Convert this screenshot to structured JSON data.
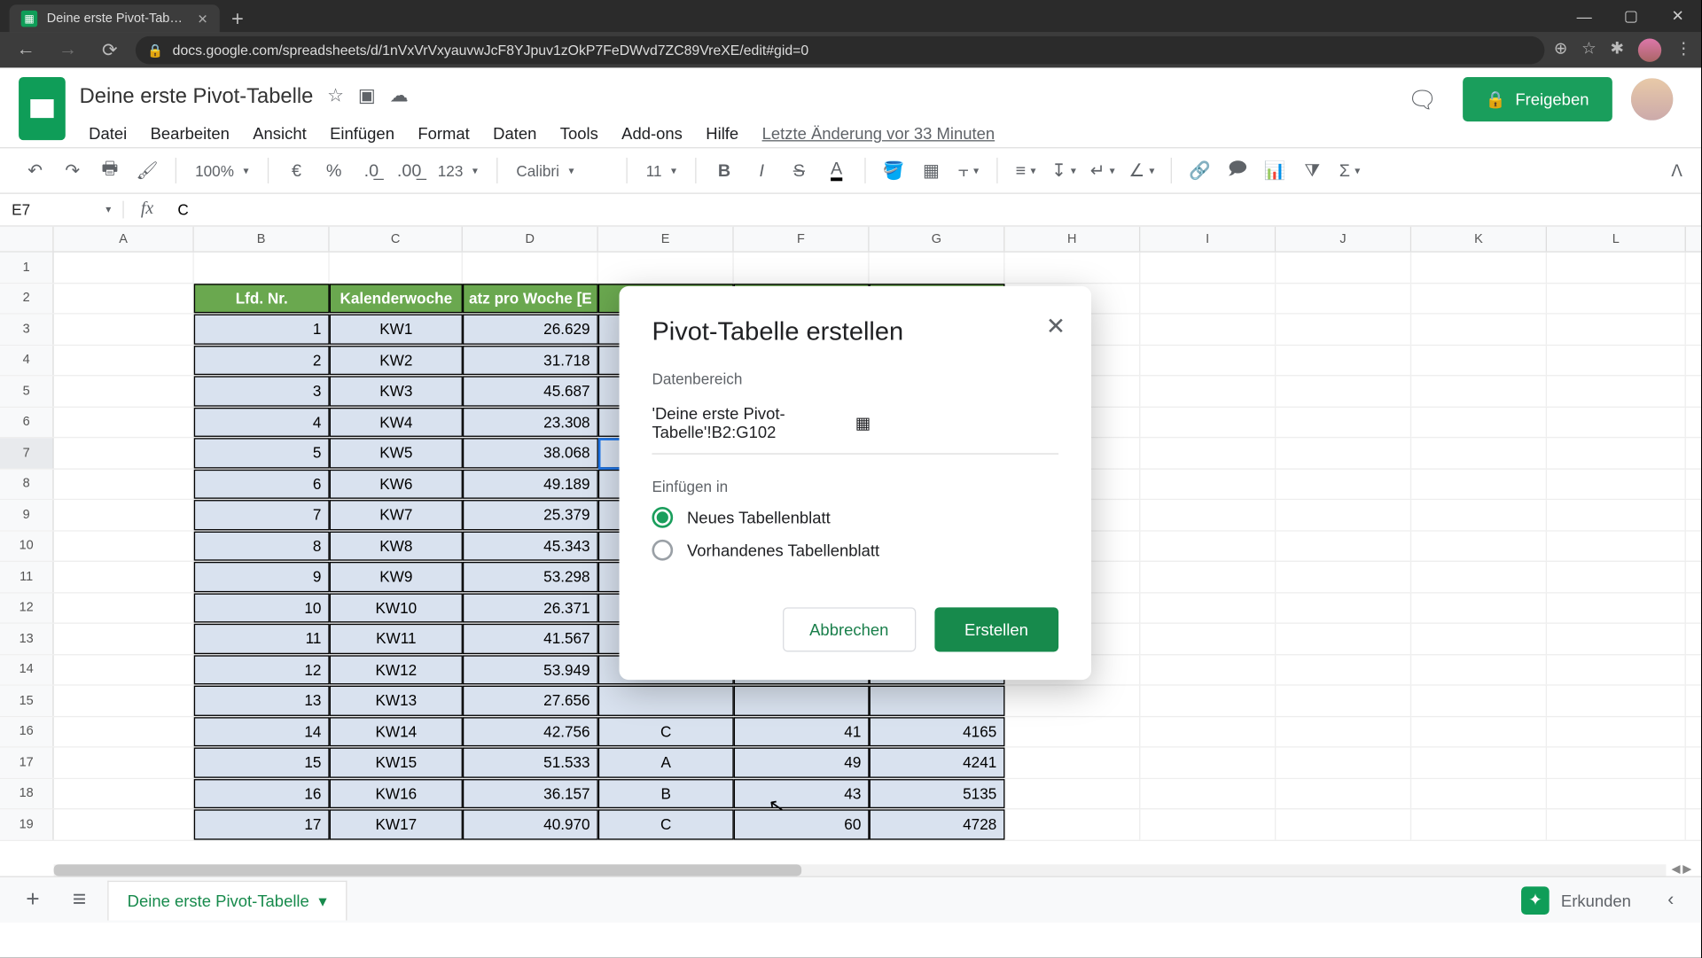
{
  "browser": {
    "tab_title": "Deine erste Pivot-Tabelle - Goog…",
    "url": "docs.google.com/spreadsheets/d/1nVxVrVxyauvwJcF8YJpuv1zOkP7FeDWvd7ZC89VreXE/edit#gid=0"
  },
  "doc": {
    "title": "Deine erste Pivot-Tabelle",
    "last_edit": "Letzte Änderung vor 33 Minuten"
  },
  "menu": {
    "file": "Datei",
    "edit": "Bearbeiten",
    "view": "Ansicht",
    "insert": "Einfügen",
    "format": "Format",
    "data": "Daten",
    "tools": "Tools",
    "addons": "Add-ons",
    "help": "Hilfe"
  },
  "share_label": "Freigeben",
  "toolbar": {
    "zoom": "100%",
    "currency": "€",
    "percent": "%",
    "dec_dec": ".0",
    "dec_inc": ".00",
    "numfmt": "123",
    "font": "Calibri",
    "size": "11"
  },
  "namebox": "E7",
  "fx_value": "C",
  "columns": [
    "A",
    "B",
    "C",
    "D",
    "E",
    "F",
    "G",
    "H",
    "I",
    "J",
    "K",
    "L"
  ],
  "col_w": [
    "wA",
    "wB",
    "wC",
    "wD",
    "wE",
    "wF",
    "wG",
    "wH",
    "wI",
    "wJ",
    "wK",
    "wL"
  ],
  "headers": {
    "b": "Lfd. Nr.",
    "c": "Kalenderwoche",
    "d": "atz pro Woche [E"
  },
  "rows": [
    {
      "n": 1
    },
    {
      "n": 2,
      "hdr": true
    },
    {
      "n": 3,
      "b": "1",
      "c": "KW1",
      "d": "26.629"
    },
    {
      "n": 4,
      "b": "2",
      "c": "KW2",
      "d": "31.718"
    },
    {
      "n": 5,
      "b": "3",
      "c": "KW3",
      "d": "45.687"
    },
    {
      "n": 6,
      "b": "4",
      "c": "KW4",
      "d": "23.308"
    },
    {
      "n": 7,
      "b": "5",
      "c": "KW5",
      "d": "38.068",
      "sel": true
    },
    {
      "n": 8,
      "b": "6",
      "c": "KW6",
      "d": "49.189"
    },
    {
      "n": 9,
      "b": "7",
      "c": "KW7",
      "d": "25.379"
    },
    {
      "n": 10,
      "b": "8",
      "c": "KW8",
      "d": "45.343"
    },
    {
      "n": 11,
      "b": "9",
      "c": "KW9",
      "d": "53.298"
    },
    {
      "n": 12,
      "b": "10",
      "c": "KW10",
      "d": "26.371"
    },
    {
      "n": 13,
      "b": "11",
      "c": "KW11",
      "d": "41.567"
    },
    {
      "n": 14,
      "b": "12",
      "c": "KW12",
      "d": "53.949"
    },
    {
      "n": 15,
      "b": "13",
      "c": "KW13",
      "d": "27.656"
    },
    {
      "n": 16,
      "b": "14",
      "c": "KW14",
      "d": "42.756",
      "e": "C",
      "f": "41",
      "g": "4165"
    },
    {
      "n": 17,
      "b": "15",
      "c": "KW15",
      "d": "51.533",
      "e": "A",
      "f": "49",
      "g": "4241"
    },
    {
      "n": 18,
      "b": "16",
      "c": "KW16",
      "d": "36.157",
      "e": "B",
      "f": "43",
      "g": "5135"
    },
    {
      "n": 19,
      "b": "17",
      "c": "KW17",
      "d": "40.970",
      "e": "C",
      "f": "60",
      "g": "4728"
    }
  ],
  "dialog": {
    "title": "Pivot-Tabelle erstellen",
    "range_label": "Datenbereich",
    "range_value": "'Deine erste Pivot-Tabelle'!B2:G102",
    "insert_label": "Einfügen in",
    "opt_new": "Neues Tabellenblatt",
    "opt_existing": "Vorhandenes Tabellenblatt",
    "cancel": "Abbrechen",
    "create": "Erstellen"
  },
  "sheetbar": {
    "tab": "Deine erste Pivot-Tabelle",
    "explore": "Erkunden"
  }
}
